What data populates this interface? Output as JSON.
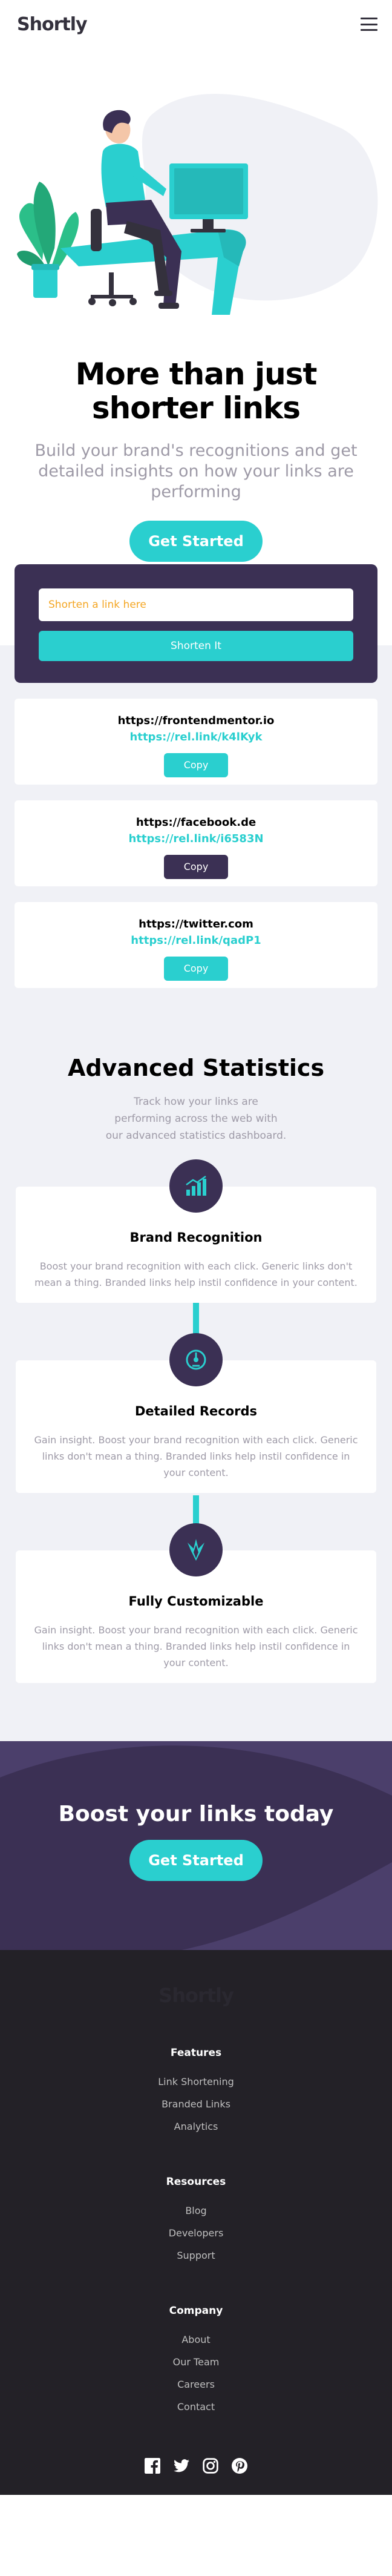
{
  "header": {
    "logo": "Shortly",
    "menu_icon": "hamburger-icon"
  },
  "hero": {
    "title": "More than just shorter links",
    "subtitle": "Build your brand's recognitions and get detailed insights on how your links are performing",
    "cta": "Get Started",
    "illustration": "person-working-illustration"
  },
  "shorten": {
    "placeholder": "Shorten a link here",
    "button": "Shorten It"
  },
  "links": [
    {
      "original": "https://frontendmentor.io",
      "short": "https://rel.link/k4lKyk",
      "button": "Copy",
      "copied": false
    },
    {
      "original": "https://facebook.de",
      "short": "https://rel.link/i6583N",
      "button": "Copy",
      "copied": true
    },
    {
      "original": "https://twitter.com",
      "short": "https://rel.link/qadP1",
      "button": "Copy",
      "copied": false
    }
  ],
  "stats": {
    "title": "Advanced Statistics",
    "subtitle": "Track how your links are performing across the web with our advanced statistics dashboard.",
    "features": [
      {
        "icon": "chart-icon",
        "title": "Brand Recognition",
        "text": "Boost your brand recognition with each click. Generic links don't mean a thing. Branded links help instil confidence in your content."
      },
      {
        "icon": "gauge-icon",
        "title": "Detailed Records",
        "text": "Gain insight. Boost your brand recognition with each click. Generic links don't mean a thing. Branded links help instil confidence in your content."
      },
      {
        "icon": "brush-icon",
        "title": "Fully Customizable",
        "text": "Gain insight. Boost your brand recognition with each click. Generic links don't mean a thing. Branded links help instil confidence in your content."
      }
    ]
  },
  "boost": {
    "title": "Boost your links today",
    "cta": "Get Started"
  },
  "footer": {
    "logo": "Shortly",
    "columns": [
      {
        "heading": "Features",
        "links": [
          "Link Shortening",
          "Branded Links",
          "Analytics"
        ]
      },
      {
        "heading": "Resources",
        "links": [
          "Blog",
          "Developers",
          "Support"
        ]
      },
      {
        "heading": "Company",
        "links": [
          "About",
          "Our Team",
          "Careers",
          "Contact"
        ]
      }
    ],
    "socials": [
      "facebook-icon",
      "twitter-icon",
      "instagram-icon",
      "pinterest-icon"
    ]
  },
  "colors": {
    "primary_cyan": "#2acfcf",
    "dark_violet": "#3b3054",
    "very_dark_violet": "#232127",
    "grayish_violet": "#9e9aa7",
    "light_gray_bg": "#f0f1f6"
  }
}
